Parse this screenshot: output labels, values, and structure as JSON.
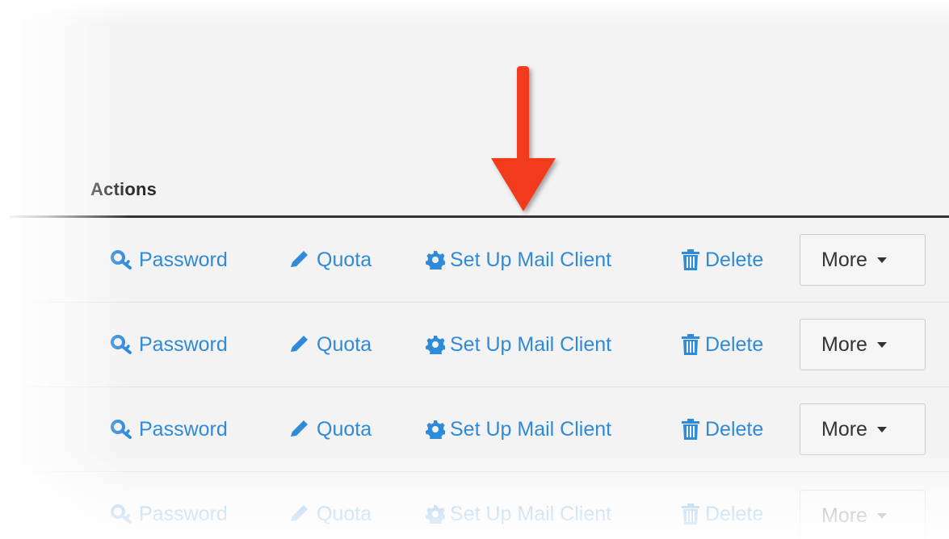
{
  "header": {
    "title": "Actions"
  },
  "rows": [
    {
      "password_label": "Password",
      "quota_label": "Quota",
      "setup_label": "Set Up Mail Client",
      "delete_label": "Delete",
      "more_label": "More"
    },
    {
      "password_label": "Password",
      "quota_label": "Quota",
      "setup_label": "Set Up Mail Client",
      "delete_label": "Delete",
      "more_label": "More"
    },
    {
      "password_label": "Password",
      "quota_label": "Quota",
      "setup_label": "Set Up Mail Client",
      "delete_label": "Delete",
      "more_label": "More"
    },
    {
      "password_label": "Password",
      "quota_label": "Quota",
      "setup_label": "Set Up Mail Client",
      "delete_label": "Delete",
      "more_label": "More"
    }
  ],
  "icons": {
    "password": "key-icon",
    "quota": "pencil-icon",
    "setup": "gear-icon",
    "delete": "trash-icon",
    "more": "caret-down-icon",
    "annotation": "red-arrow-icon"
  },
  "colors": {
    "link": "#2f8ad8",
    "annotation_arrow": "#f23a1f",
    "background": "#f3f3f3"
  }
}
